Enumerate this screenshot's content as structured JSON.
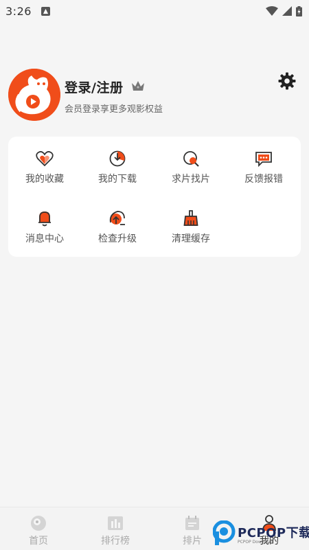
{
  "status_bar": {
    "time": "3:26"
  },
  "profile": {
    "title": "登录/注册",
    "subtitle": "会员登录享更多观影权益"
  },
  "grid": [
    {
      "label": "我的收藏",
      "icon": "heart-icon"
    },
    {
      "label": "我的下载",
      "icon": "download-icon"
    },
    {
      "label": "求片找片",
      "icon": "search-film-icon"
    },
    {
      "label": "反馈报错",
      "icon": "feedback-icon"
    },
    {
      "label": "消息中心",
      "icon": "bell-icon"
    },
    {
      "label": "检查升级",
      "icon": "upgrade-icon"
    },
    {
      "label": "清理缓存",
      "icon": "broom-icon"
    }
  ],
  "bottom_nav": [
    {
      "label": "首页",
      "icon": "home-icon"
    },
    {
      "label": "排行榜",
      "icon": "ranking-icon"
    },
    {
      "label": "排片",
      "icon": "calendar-icon"
    },
    {
      "label": "我的",
      "icon": "profile-icon"
    }
  ],
  "watermark": {
    "brand": "PCPOP下载",
    "small": "PCPOP Download"
  },
  "colors": {
    "accent": "#F04D1A",
    "background": "#F5F5F5",
    "card": "#FFFFFF"
  }
}
